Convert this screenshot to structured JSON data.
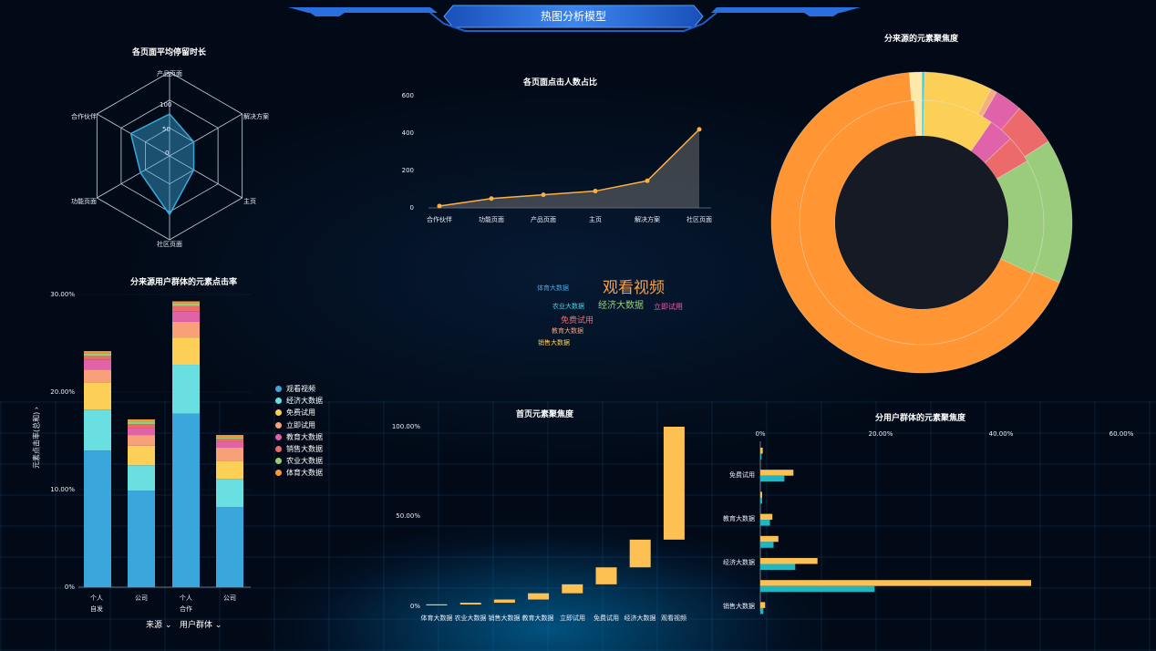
{
  "header": {
    "title": "热图分析模型"
  },
  "radar": {
    "title": "各页面平均停留时长",
    "scale_labels": [
      "100",
      "50",
      "0"
    ],
    "chart_data": {
      "type": "radar",
      "indicators": [
        "产品页面",
        "解决方案",
        "主页",
        "社区页面",
        "功能页面",
        "合作伙伴"
      ],
      "max": 150,
      "values": [
        75,
        50,
        50,
        105,
        60,
        80
      ]
    }
  },
  "line": {
    "title": "各页面点击人数占比",
    "y_ticks": [
      "600",
      "400",
      "200",
      "0"
    ],
    "chart_data": {
      "type": "area",
      "categories": [
        "合作伙伴",
        "功能页面",
        "产品页面",
        "主页",
        "解决方案",
        "社区页面"
      ],
      "values": [
        10,
        50,
        70,
        90,
        145,
        420
      ],
      "ylim": [
        0,
        600
      ]
    }
  },
  "donut": {
    "title": "分来源的元素聚焦度",
    "chart_data": {
      "type": "pie",
      "inner": [
        {
          "name": "slice-a",
          "value": 1,
          "color": "#47d3e1"
        },
        {
          "name": "slice-b",
          "value": 28,
          "color": "#fcd057"
        },
        {
          "name": "slice-c",
          "value": 10,
          "color": "#e062a8"
        },
        {
          "name": "slice-d",
          "value": 11,
          "color": "#ec6a6a"
        },
        {
          "name": "slice-e",
          "value": 46,
          "color": "#9acc7b"
        },
        {
          "name": "slice-f",
          "value": 202,
          "color": "#ff9533"
        },
        {
          "name": "slice-g",
          "value": 3,
          "color": "#ffe9a8"
        }
      ],
      "outer": [
        {
          "name": "slice-a",
          "value": 1,
          "color": "#47d3e1"
        },
        {
          "name": "slice-b",
          "value": 22,
          "color": "#fcd057"
        },
        {
          "name": "slice-b2",
          "value": 2,
          "color": "#f4b07a"
        },
        {
          "name": "slice-c",
          "value": 9,
          "color": "#e062a8"
        },
        {
          "name": "slice-d",
          "value": 14,
          "color": "#ec6a6a"
        },
        {
          "name": "slice-e",
          "value": 47,
          "color": "#9acc7b"
        },
        {
          "name": "slice-f",
          "value": 202,
          "color": "#ff9533"
        },
        {
          "name": "slice-g",
          "value": 4,
          "color": "#ffe9a8"
        }
      ]
    }
  },
  "stacked": {
    "title": "分来源用户群体的元素点击率",
    "y_ticks": [
      "30.00%",
      "20.00%",
      "10.00%",
      "0%"
    ],
    "y_axis_label": "元素点击率(总和)",
    "x_groups": [
      {
        "sub": [
          "个人",
          "公司"
        ],
        "name": "自发"
      },
      {
        "sub": [
          "个人",
          "公司"
        ],
        "name": "合作"
      }
    ],
    "legend": [
      {
        "label": "观看视频",
        "color": "#3aa7dc"
      },
      {
        "label": "经济大数据",
        "color": "#6adfe2"
      },
      {
        "label": "免费试用",
        "color": "#fcd057"
      },
      {
        "label": "立即试用",
        "color": "#f8a07a"
      },
      {
        "label": "教育大数据",
        "color": "#e062a8"
      },
      {
        "label": "销售大数据",
        "color": "#ec6a6a"
      },
      {
        "label": "农业大数据",
        "color": "#9acc7b"
      },
      {
        "label": "体育大数据",
        "color": "#ff9533"
      }
    ],
    "controls": {
      "source": "来源",
      "group": "用户群体"
    },
    "chart_data": {
      "type": "bar",
      "stacked": true,
      "ylim": [
        0,
        30
      ],
      "bars": [
        [
          14.0,
          4.2,
          2.8,
          1.3,
          1.0,
          0.4,
          0.3,
          0.2
        ],
        [
          9.9,
          2.6,
          2.0,
          1.1,
          0.7,
          0.4,
          0.3,
          0.2
        ],
        [
          17.8,
          5.0,
          2.8,
          1.6,
          1.1,
          0.5,
          0.3,
          0.2
        ],
        [
          8.2,
          2.9,
          1.8,
          1.4,
          0.6,
          0.3,
          0.2,
          0.2
        ]
      ]
    }
  },
  "wordcloud": {
    "words": [
      {
        "text": "观看视频",
        "color": "#f5a04a",
        "size": 17
      },
      {
        "text": "经济大数据",
        "color": "#9acc7b",
        "size": 10
      },
      {
        "text": "立即试用",
        "color": "#e062a8",
        "size": 8
      },
      {
        "text": "体育大数据",
        "color": "#47a8e0",
        "size": 7
      },
      {
        "text": "农业大数据",
        "color": "#47d3e1",
        "size": 7
      },
      {
        "text": "免费试用",
        "color": "#ec6a6a",
        "size": 9
      },
      {
        "text": "教育大数据",
        "color": "#f8a07a",
        "size": 7
      },
      {
        "text": "销售大数据",
        "color": "#fcd057",
        "size": 7
      }
    ]
  },
  "waterfall": {
    "title": "首页元素聚焦度",
    "y_ticks": [
      "100.00%",
      "50.00%",
      "0%"
    ],
    "chart_data": {
      "type": "bar",
      "waterfall": true,
      "categories": [
        "体育大数据",
        "农业大数据",
        "销售大数据",
        "教育大数据",
        "立即试用",
        "免费试用",
        "经济大数据",
        "观看视频"
      ],
      "values": [
        0.5,
        1.0,
        1.8,
        3.5,
        5.0,
        9.5,
        15.5,
        63.2
      ],
      "ylim": [
        0,
        100
      ]
    }
  },
  "hbar": {
    "title": "分用户群体的元素聚焦度",
    "x_ticks": [
      "0%",
      "20.00%",
      "40.00%",
      "60.00%"
    ],
    "y_labels": [
      "免费试用",
      "教育大数据",
      "经济大数据",
      "销售大数据"
    ],
    "chart_data": {
      "type": "bar",
      "orientation": "horizontal",
      "xlim": [
        0,
        60
      ],
      "series": [
        {
          "color": "#fcc152",
          "values": [
            0.4,
            5.5,
            0.3,
            2.0,
            3.0,
            9.5,
            45.0,
            0.8
          ]
        },
        {
          "color": "#1fb7c2",
          "values": [
            0.2,
            4.0,
            0.3,
            1.6,
            2.2,
            5.8,
            19.0,
            0.5
          ]
        }
      ]
    }
  }
}
